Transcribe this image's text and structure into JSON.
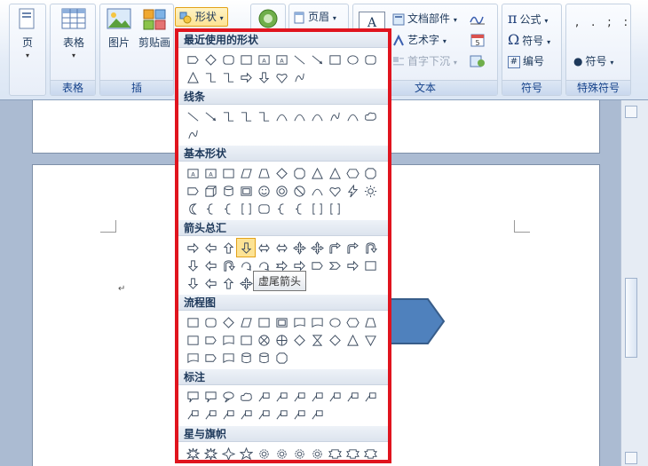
{
  "ribbon": {
    "page_group": {
      "btn": "页",
      "label": ""
    },
    "table_group": {
      "btn": "表格",
      "label": "表格"
    },
    "insert_group": {
      "picture": "图片",
      "clipart": "剪贴画",
      "label": "插"
    },
    "shapes_btn": "形状",
    "header_btn": "页眉",
    "text_group": {
      "parts": "文档部件",
      "wordart": "艺术字",
      "dropcap": "首字下沉",
      "label": "文本"
    },
    "symbols_group": {
      "formula": "公式",
      "symbol": "符号",
      "numbering": "编号",
      "label": "符号"
    },
    "special_group": {
      "symbol_btn": "符号",
      "label": "特殊符号",
      "chars": ",.;:"
    }
  },
  "gallery": {
    "sections": [
      {
        "title": "最近使用的形状"
      },
      {
        "title": "线条"
      },
      {
        "title": "基本形状"
      },
      {
        "title": "箭头总汇"
      },
      {
        "title": "流程图"
      },
      {
        "title": "标注"
      },
      {
        "title": "星与旗帜"
      }
    ]
  },
  "tooltip": "虚尾箭头",
  "colors": {
    "highlight_border": "#e0141e",
    "shape_fill": "#4f81bd",
    "selected": "#fde394"
  }
}
